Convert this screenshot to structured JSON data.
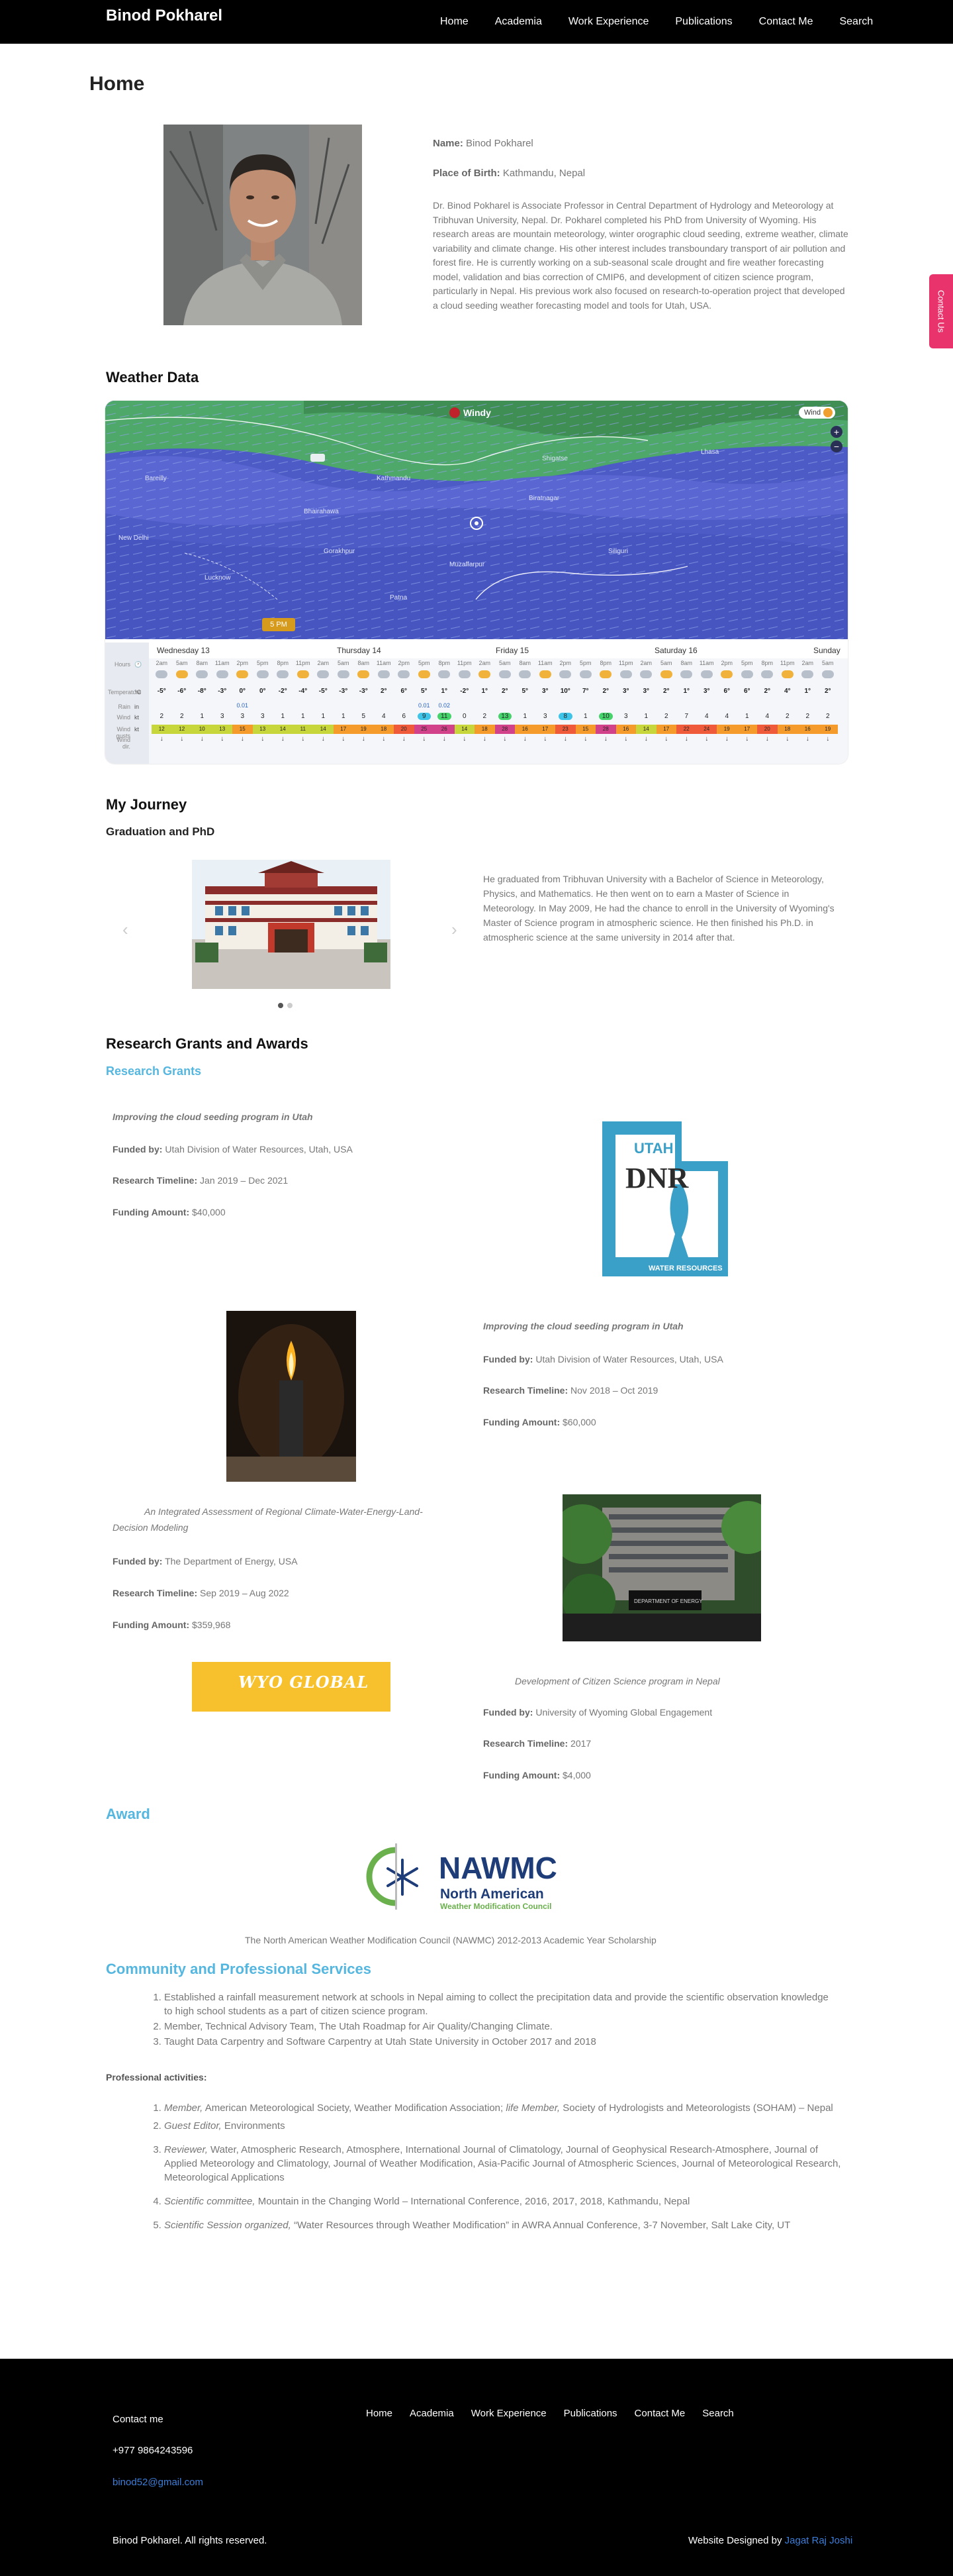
{
  "header": {
    "brand": "Binod Pokharel",
    "nav": [
      "Home",
      "Academia",
      "Work Experience",
      "Publications",
      "Contact Me",
      "Search"
    ]
  },
  "contact_tab": "Contact Us",
  "page_title": "Home",
  "profile": {
    "name_label": "Name:",
    "name": "Binod Pokharel",
    "birth_label": "Place of Birth:",
    "birth": "Kathmandu, Nepal",
    "bio": "Dr. Binod Pokharel is Associate Professor in Central Department of Hydrology and Meteorology at Tribhuvan University, Nepal. Dr. Pokharel completed his PhD from University of Wyoming. His research areas are mountain meteorology, winter orographic cloud seeding, extreme weather, climate variability and climate change. His other interest includes transboundary transport of air pollution and forest fire. He is currently working on a sub-seasonal scale drought and fire weather forecasting model, validation and bias correction of CMIP6, and development of citizen science program, particularly in Nepal. His previous work also focused on research-to-operation project that developed a cloud seeding weather forecasting model and tools for Utah, USA."
  },
  "weather": {
    "heading": "Weather Data",
    "brand": "Windy",
    "layer_label": "Wind",
    "zoom_in": "+",
    "zoom_out": "−",
    "time_marker": "5 PM",
    "map_labels": [
      "Kathmandu",
      "Biratnagar",
      "Bhairahawa",
      "Lucknow",
      "Bareilly",
      "Patna",
      "Gorakhpur",
      "Siliguri",
      "New Delhi",
      "Shigatse",
      "Lhasa",
      "Muzaffarpur"
    ],
    "days": [
      "Wednesday 13",
      "Thursday 14",
      "Friday 15",
      "Saturday 16",
      "Sunday"
    ],
    "row_labels": [
      "Hours",
      "Temperature",
      "Rain",
      "Wind",
      "Wind gusts",
      "Wind dir."
    ],
    "units": [
      "🕐",
      "°C",
      "in",
      "kt",
      "kt",
      ""
    ],
    "hours": [
      "2am",
      "5am",
      "8am",
      "11am",
      "2pm",
      "5pm",
      "8pm",
      "11pm",
      "2am",
      "5am",
      "8am",
      "11am",
      "2pm",
      "5pm",
      "8pm",
      "11pm",
      "2am",
      "5am",
      "8am",
      "11am",
      "2pm",
      "5pm",
      "8pm",
      "11pm",
      "2am",
      "5am",
      "8am",
      "11am",
      "2pm",
      "5pm",
      "8pm",
      "11pm",
      "2am",
      "5am",
      "8am",
      "11am",
      "2pm",
      "5pm",
      "8pm"
    ],
    "temps": [
      "-5°",
      "-6°",
      "-8°",
      "-3°",
      "0°",
      "0°",
      "-2°",
      "-4°",
      "-5°",
      "-3°",
      "-3°",
      "2°",
      "6°",
      "5°",
      "1°",
      "-2°",
      "1°",
      "2°",
      "5°",
      "3°",
      "10°",
      "7°",
      "2°",
      "3°",
      "3°",
      "2°",
      "1°",
      "3°",
      "6°",
      "6°",
      "2°",
      "4°",
      "1°",
      "2°",
      "0°"
    ],
    "rain": [
      "",
      "",
      "",
      "",
      "0.01",
      "",
      "",
      "",
      "",
      "",
      "",
      "",
      "",
      "0.01",
      "0.02",
      "",
      "",
      "",
      "",
      "",
      "",
      "",
      "",
      "",
      "",
      "",
      "",
      "",
      "",
      "",
      "",
      "",
      "",
      "",
      ""
    ],
    "wind": [
      "2",
      "2",
      "1",
      "3",
      "3",
      "3",
      "1",
      "1",
      "1",
      "1",
      "5",
      "4",
      "6",
      "9",
      "11",
      "0",
      "2",
      "13",
      "1",
      "3",
      "8",
      "1",
      "10",
      "3",
      "1",
      "2",
      "7",
      "4",
      "4",
      "1",
      "4",
      "2",
      "2",
      "2",
      "3"
    ],
    "gusts": [
      "12",
      "12",
      "10",
      "13",
      "15",
      "13",
      "14",
      "11",
      "14",
      "17",
      "19",
      "18",
      "20",
      "25",
      "26",
      "14",
      "18",
      "28",
      "16",
      "17",
      "23",
      "15",
      "28",
      "16",
      "14",
      "17",
      "22",
      "24",
      "19",
      "17",
      "20",
      "18",
      "16",
      "19",
      "23"
    ]
  },
  "journey": {
    "heading": "My Journey",
    "subheading": "Graduation and PhD",
    "text": "He graduated from Tribhuvan University with a Bachelor of Science in Meteorology, Physics, and Mathematics. He then went on to earn a Master of Science in Meteorology. In May 2009, He had the chance to enroll in the University of Wyoming's Master of Science program in atmospheric science. He then finished his Ph.D. in atmospheric science at the same university in 2014 after that.",
    "prev": "‹",
    "next": "›"
  },
  "grants_section": {
    "heading": "Research Grants and Awards",
    "subheading": "Research Grants",
    "funded_label": "Funded by:",
    "timeline_label": "Research Timeline:",
    "amount_label": "Funding Amount:",
    "grants": [
      {
        "title": "Improving the cloud seeding program in Utah",
        "funded": "Utah Division of Water Resources, Utah, USA",
        "timeline": "Jan 2019 – Dec 2021",
        "amount": "$40,000"
      },
      {
        "title": "Improving the cloud seeding program in Utah",
        "funded": "Utah Division of Water Resources, Utah, USA",
        "timeline": "Nov 2018 – Oct 2019",
        "amount": "$60,000"
      },
      {
        "title": "An Integrated Assessment of Regional Climate-Water-Energy-Land-Decision Modeling",
        "funded": "The Department of Energy, USA",
        "timeline": "Sep 2019 – Aug 2022",
        "amount": "$359,968"
      },
      {
        "title": "Development of Citizen Science program in Nepal",
        "funded": "University of Wyoming Global Engagement",
        "timeline": "2017",
        "amount": "$4,000"
      }
    ],
    "dnr_logo": {
      "top": "UTAH",
      "main": "DNR",
      "bottom": "WATER RESOURCES"
    },
    "doe_sign": "DEPARTMENT OF ENERGY",
    "wyo_logo": "WYO GLOBAL"
  },
  "award": {
    "heading": "Award",
    "logo_main": "NAWMC",
    "logo_sub1": "North American",
    "logo_sub2": "Weather Modification Council",
    "caption": "The North American Weather Modification Council (NAWMC) 2012-2013 Academic Year Scholarship"
  },
  "community": {
    "heading": "Community and Professional Services",
    "items": [
      "Established a rainfall measurement network at schools in Nepal aiming to collect the precipitation data and provide the scientific observation knowledge to high school students as a part of citizen science program.",
      "Member, Technical Advisory Team, The Utah Roadmap for Air Quality/Changing Climate.",
      "Taught Data Carpentry and Software Carpentry at Utah State University in October 2017 and 2018"
    ],
    "prof_heading": "Professional activities:",
    "prof_items": [
      {
        "role": "Member,",
        "text": "American Meteorological Society, Weather Modification Association;",
        "role2": "life Member,",
        "text2": "Society of Hydrologists and Meteorologists (SOHAM) – Nepal"
      },
      {
        "role": "Guest Editor,",
        "text": "Environments"
      },
      {
        "role": "Reviewer,",
        "text": "Water, Atmospheric Research, Atmosphere, International Journal of Climatology, Journal of Geophysical Research-Atmosphere, Journal of Applied Meteorology and Climatology, Journal of Weather Modification, Asia-Pacific Journal of Atmospheric Sciences, Journal of Meteorological Research, Meteorological Applications"
      },
      {
        "role": "Scientific committee,",
        "text": "Mountain in the Changing World – International Conference, 2016, 2017, 2018, Kathmandu, Nepal"
      },
      {
        "role": "Scientific Session organized,",
        "text": "“Water Resources through Weather Modification” in AWRA Annual Conference, 3-7 November, Salt Lake City, UT"
      }
    ]
  },
  "footer": {
    "contact_heading": "Contact me",
    "phone": "+977 9864243596",
    "email": "binod52@gmail.com",
    "nav": [
      "Home",
      "Academia",
      "Work Experience",
      "Publications",
      "Contact Me",
      "Search"
    ],
    "copyright": "Binod Pokharel. All rights reserved.",
    "designed_label": "Website Designed by",
    "designer": "Jagat Raj Joshi"
  },
  "colors": {
    "accent_blue": "#55b7e0",
    "contact_pink": "#e8336c",
    "link_blue": "#3b7dd8"
  }
}
